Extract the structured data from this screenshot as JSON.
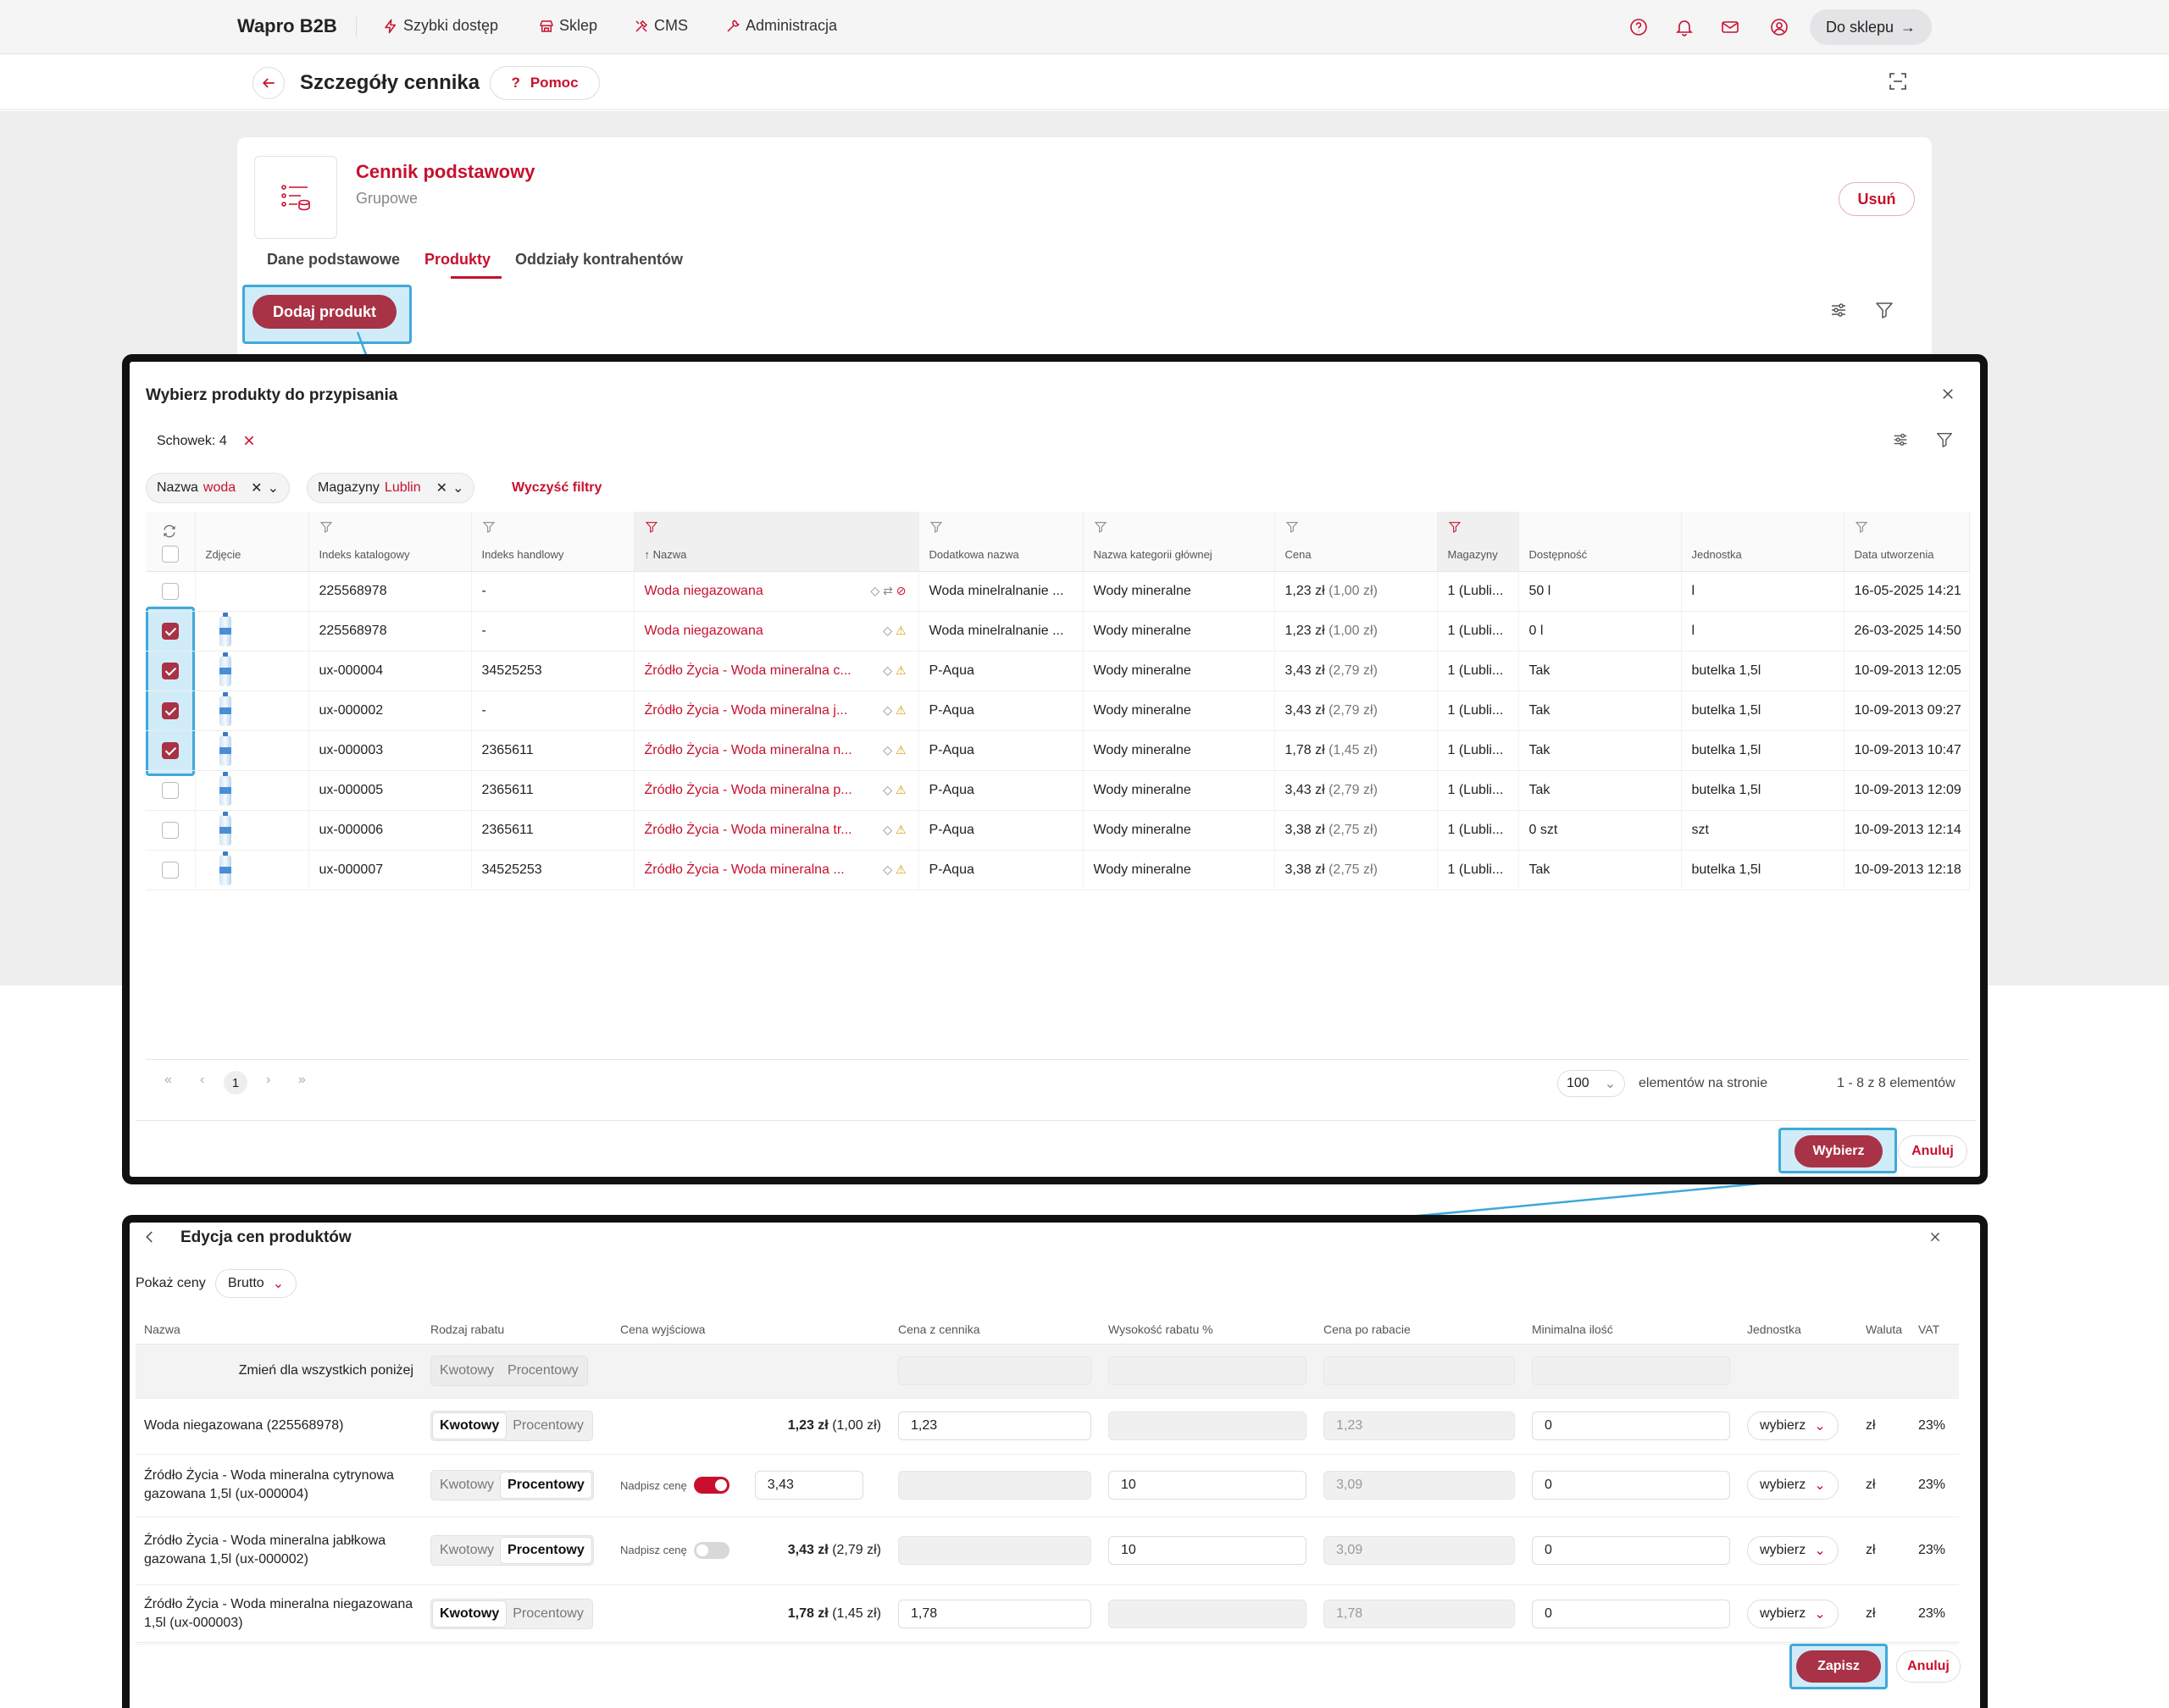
{
  "topbar": {
    "brand": "Wapro B2B",
    "nav": [
      "Szybki dostęp",
      "Sklep",
      "CMS",
      "Administracja"
    ],
    "shop_button": "Do sklepu"
  },
  "header": {
    "title": "Szczegóły cennika",
    "help": "Pomoc"
  },
  "card": {
    "name": "Cennik podstawowy",
    "type": "Grupowe",
    "delete": "Usuń",
    "tabs": [
      "Dane podstawowe",
      "Produkty",
      "Oddziały kontrahentów"
    ],
    "active_tab": "Produkty",
    "add_button": "Dodaj produkt"
  },
  "select_dialog": {
    "title": "Wybierz produkty do przypisania",
    "clipboard": "Schowek: 4",
    "filters": [
      {
        "label": "Nazwa",
        "value": "woda"
      },
      {
        "label": "Magazyny",
        "value": "Lublin"
      }
    ],
    "clear_filters": "Wyczyść filtry",
    "columns": [
      "Zdjęcie",
      "Indeks katalogowy",
      "Indeks handlowy",
      "Nazwa",
      "Dodatkowa nazwa",
      "Nazwa kategorii głównej",
      "Cena",
      "Magazyny",
      "Dostępność",
      "Jednostka",
      "Data utworzenia"
    ],
    "rows": [
      {
        "checked": false,
        "photo": false,
        "cat": "225568978",
        "trade": "-",
        "name": "Woda niegazowana",
        "extra": "Woda minelralnanie ...",
        "category": "Wody mineralne",
        "price": "1,23 zł",
        "price_net": "(1,00 zł)",
        "stores": "1 (Lubli...",
        "avail": "50 l",
        "avail_color": "green",
        "unit": "l",
        "date": "16-05-2025 14:21"
      },
      {
        "checked": true,
        "photo": true,
        "cat": "225568978",
        "trade": "-",
        "name": "Woda niegazowana",
        "extra": "Woda minelralnanie ...",
        "category": "Wody mineralne",
        "price": "1,23 zł",
        "price_net": "(1,00 zł)",
        "stores": "1 (Lubli...",
        "avail": "0 l",
        "avail_color": "red",
        "unit": "l",
        "date": "26-03-2025 14:50"
      },
      {
        "checked": true,
        "photo": true,
        "cat": "ux-000004",
        "trade": "34525253",
        "name": "Źródło Życia - Woda mineralna c...",
        "extra": "P-Aqua",
        "category": "Wody mineralne",
        "price": "3,43 zł",
        "price_net": "(2,79 zł)",
        "stores": "1 (Lubli...",
        "avail": "Tak",
        "avail_color": "green",
        "unit": "butelka 1,5l",
        "date": "10-09-2013 12:05"
      },
      {
        "checked": true,
        "photo": true,
        "cat": "ux-000002",
        "trade": "-",
        "name": "Źródło Życia - Woda mineralna j...",
        "extra": "P-Aqua",
        "category": "Wody mineralne",
        "price": "3,43 zł",
        "price_net": "(2,79 zł)",
        "stores": "1 (Lubli...",
        "avail": "Tak",
        "avail_color": "green",
        "unit": "butelka 1,5l",
        "date": "10-09-2013 09:27"
      },
      {
        "checked": true,
        "photo": true,
        "cat": "ux-000003",
        "trade": "2365611",
        "name": "Źródło Życia - Woda mineralna n...",
        "extra": "P-Aqua",
        "category": "Wody mineralne",
        "price": "1,78 zł",
        "price_net": "(1,45 zł)",
        "stores": "1 (Lubli...",
        "avail": "Tak",
        "avail_color": "green",
        "unit": "butelka 1,5l",
        "date": "10-09-2013 10:47"
      },
      {
        "checked": false,
        "photo": true,
        "cat": "ux-000005",
        "trade": "2365611",
        "name": "Źródło Życia - Woda mineralna p...",
        "extra": "P-Aqua",
        "category": "Wody mineralne",
        "price": "3,43 zł",
        "price_net": "(2,79 zł)",
        "stores": "1 (Lubli...",
        "avail": "Tak",
        "avail_color": "green",
        "unit": "butelka 1,5l",
        "date": "10-09-2013 12:09"
      },
      {
        "checked": false,
        "photo": true,
        "cat": "ux-000006",
        "trade": "2365611",
        "name": "Źródło Życia - Woda mineralna tr...",
        "extra": "P-Aqua",
        "category": "Wody mineralne",
        "price": "3,38 zł",
        "price_net": "(2,75 zł)",
        "stores": "1 (Lubli...",
        "avail": "0 szt",
        "avail_color": "red",
        "unit": "szt",
        "date": "10-09-2013 12:14"
      },
      {
        "checked": false,
        "photo": true,
        "cat": "ux-000007",
        "trade": "34525253",
        "name": "Źródło Życia - Woda mineralna ...",
        "extra": "P-Aqua",
        "category": "Wody mineralne",
        "price": "3,38 zł",
        "price_net": "(2,75 zł)",
        "stores": "1 (Lubli...",
        "avail": "Tak",
        "avail_color": "green",
        "unit": "butelka 1,5l",
        "date": "10-09-2013 12:18"
      }
    ],
    "pager": {
      "page": "1",
      "page_size": "100",
      "per_page_label": "elementów na stronie",
      "range": "1 - 8 z 8 elementów"
    },
    "select_button": "Wybierz",
    "cancel_button": "Anuluj"
  },
  "edit_dialog": {
    "title": "Edycja cen produktów",
    "show_prices_label": "Pokaż ceny",
    "show_prices_value": "Brutto",
    "columns": [
      "Nazwa",
      "Rodzaj rabatu",
      "Cena wyjściowa",
      "Cena z cennika",
      "Wysokość rabatu %",
      "Cena po rabacie",
      "Minimalna ilość",
      "Jednostka",
      "Waluta",
      "VAT"
    ],
    "change_all": "Zmień dla wszystkich poniżej",
    "seg_labels": [
      "Kwotowy",
      "Procentowy"
    ],
    "override_label": "Nadpisz cenę",
    "unit_placeholder": "wybierz",
    "rows": [
      {
        "name": "Woda niegazowana (225568978)",
        "mode": "Kwotowy",
        "override": null,
        "base_price": "1,23 zł",
        "base_net": "(1,00 zł)",
        "list_price": "1,23",
        "discount": "",
        "after": "1,23",
        "min": "0",
        "currency": "zł",
        "vat": "23%"
      },
      {
        "name": "Źródło Życia - Woda mineralna cytrynowa gazowana 1,5l (ux-000004)",
        "mode": "Procentowy",
        "override": "on",
        "base_input": "3,43",
        "list_price": "",
        "discount": "10",
        "after": "3,09",
        "min": "0",
        "currency": "zł",
        "vat": "23%"
      },
      {
        "name": "Źródło Życia - Woda mineralna jabłkowa gazowana 1,5l (ux-000002)",
        "mode": "Procentowy",
        "override": "off",
        "base_price": "3,43 zł",
        "base_net": "(2,79 zł)",
        "list_price": "",
        "discount": "10",
        "after": "3,09",
        "min": "0",
        "currency": "zł",
        "vat": "23%"
      },
      {
        "name": "Źródło Życia - Woda mineralna niegazowana 1,5l (ux-000003)",
        "mode": "Kwotowy",
        "override": null,
        "base_price": "1,78 zł",
        "base_net": "(1,45 zł)",
        "list_price": "1,78",
        "discount": "",
        "after": "1,78",
        "min": "0",
        "currency": "zł",
        "vat": "23%"
      }
    ],
    "save_button": "Zapisz",
    "cancel_button": "Anuluj"
  },
  "colors": {
    "accent": "#c8102e",
    "primary_button": "#a83246",
    "highlight": "#3fa9d9",
    "available": "#2e9b3c"
  }
}
